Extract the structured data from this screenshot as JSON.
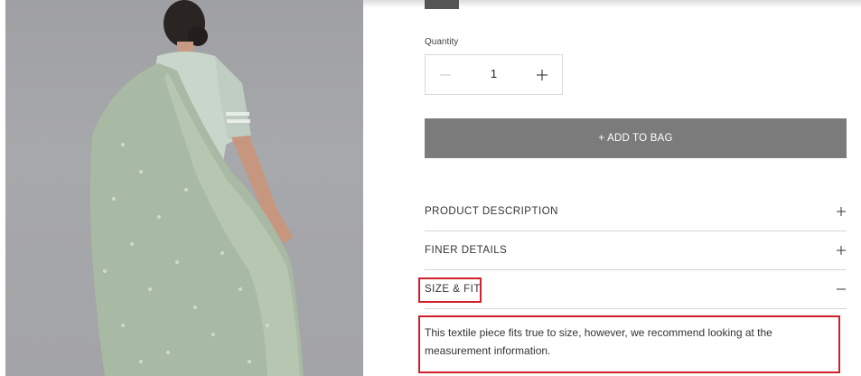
{
  "product": {
    "image_alt": "Model wearing a pale green embroidered dupatta draped over her arm"
  },
  "quantity": {
    "label": "Quantity",
    "value": "1"
  },
  "actions": {
    "add_to_bag": "+ ADD TO BAG"
  },
  "accordion": [
    {
      "title": "PRODUCT DESCRIPTION",
      "state": "collapsed"
    },
    {
      "title": "FINER DETAILS",
      "state": "collapsed"
    },
    {
      "title": "SIZE & FIT",
      "state": "expanded",
      "content": "This textile piece fits true to size, however, we recommend looking at the measurement information."
    }
  ],
  "colors": {
    "button_bg": "#7b7b7b",
    "highlight": "#d0202a",
    "divider": "#d4d4d4"
  }
}
